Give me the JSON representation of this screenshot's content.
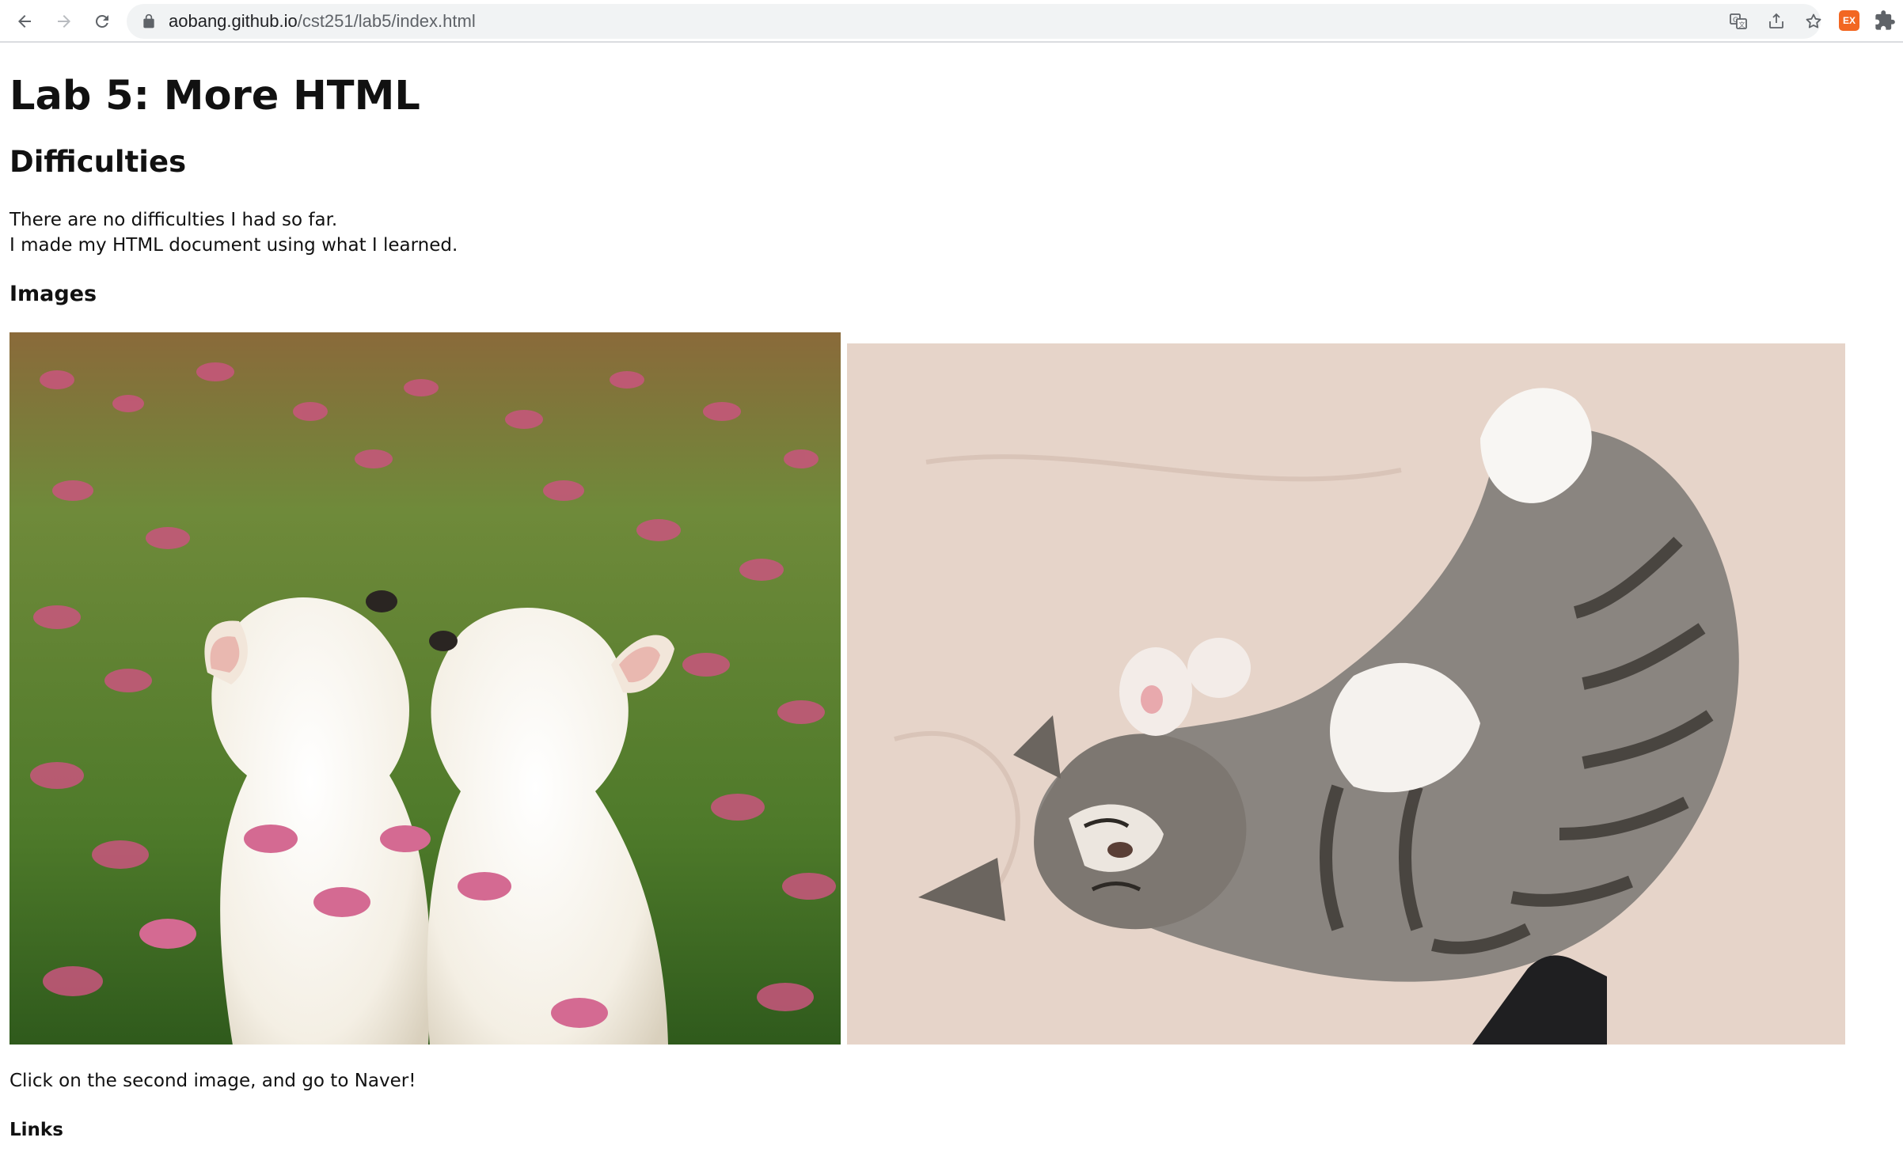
{
  "browser": {
    "url_host": "aobang.github.io",
    "url_path": "/cst251/lab5/index.html",
    "extension_badge": "EX"
  },
  "page": {
    "title": "Lab 5: More HTML",
    "difficulties_heading": "Difficulties",
    "difficulties_line1": "There are no difficulties I had so far.",
    "difficulties_line2": "I made my HTML document using what I learned.",
    "images_heading": "Images",
    "caption": "Click on the second image, and go to Naver!",
    "links_heading": "Links"
  },
  "images": {
    "first": {
      "alt": "Two white puppies in a field of pink flowers"
    },
    "second": {
      "alt": "Tabby kitten sleeping on its back on a bed"
    }
  },
  "icons": [
    "back-icon",
    "forward-icon",
    "reload-icon",
    "lock-icon",
    "translate-icon",
    "share-icon",
    "bookmark-star-icon",
    "extension-badge-icon",
    "extensions-puzzle-icon"
  ],
  "colors": {
    "chrome_bg": "#ffffff",
    "omnibox_bg": "#f1f3f4",
    "text": "#111111",
    "url_muted": "#5f6368",
    "extension_orange": "#f26722"
  }
}
